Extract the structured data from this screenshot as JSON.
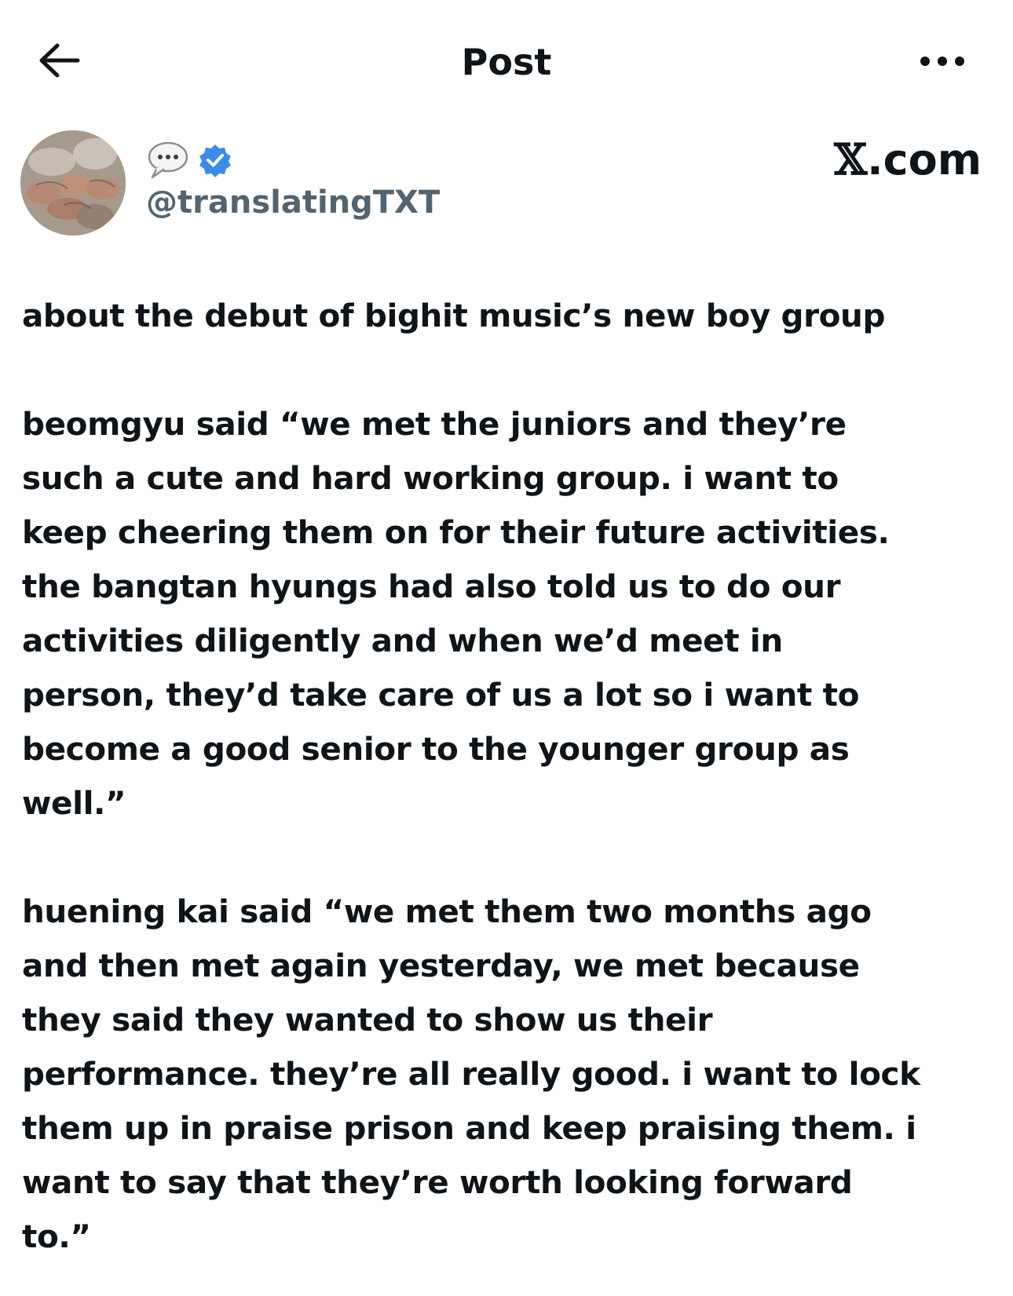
{
  "header": {
    "title": "Post",
    "back_icon": "arrow-left-icon",
    "more_icon": "more-horizontal-icon"
  },
  "author": {
    "avatar_icon": "avatar",
    "name_emoji_icon": "speech-bubble-icon",
    "verified_icon": "verified-badge-icon",
    "handle": "@translatingTXT",
    "verified_color": "#3b8ce6"
  },
  "watermark": {
    "x_glyph": "𝕏",
    "text": ".com"
  },
  "post": {
    "paragraphs": [
      {
        "lines": [
          "about the debut of bighit music’s new boy group"
        ]
      },
      {
        "lines": [
          "beomgyu said “we met the juniors and they’re",
          "such a cute and hard working group. i want to",
          "keep cheering them on for their future activities.",
          "the bangtan hyungs had also told us to do our",
          "activities diligently and when we’d meet in",
          "person, they’d take care of us a lot so i want to",
          "become a good senior to the younger group as",
          "well.”"
        ]
      },
      {
        "lines": [
          "huening kai said “we met them two months ago",
          "and then met again yesterday, we met because",
          "they said they wanted to show us their",
          "performance. they’re all really good. i want to lock",
          "them up in praise prison and keep praising them. i",
          "want to say that they’re worth looking forward",
          "to.”"
        ]
      }
    ]
  }
}
